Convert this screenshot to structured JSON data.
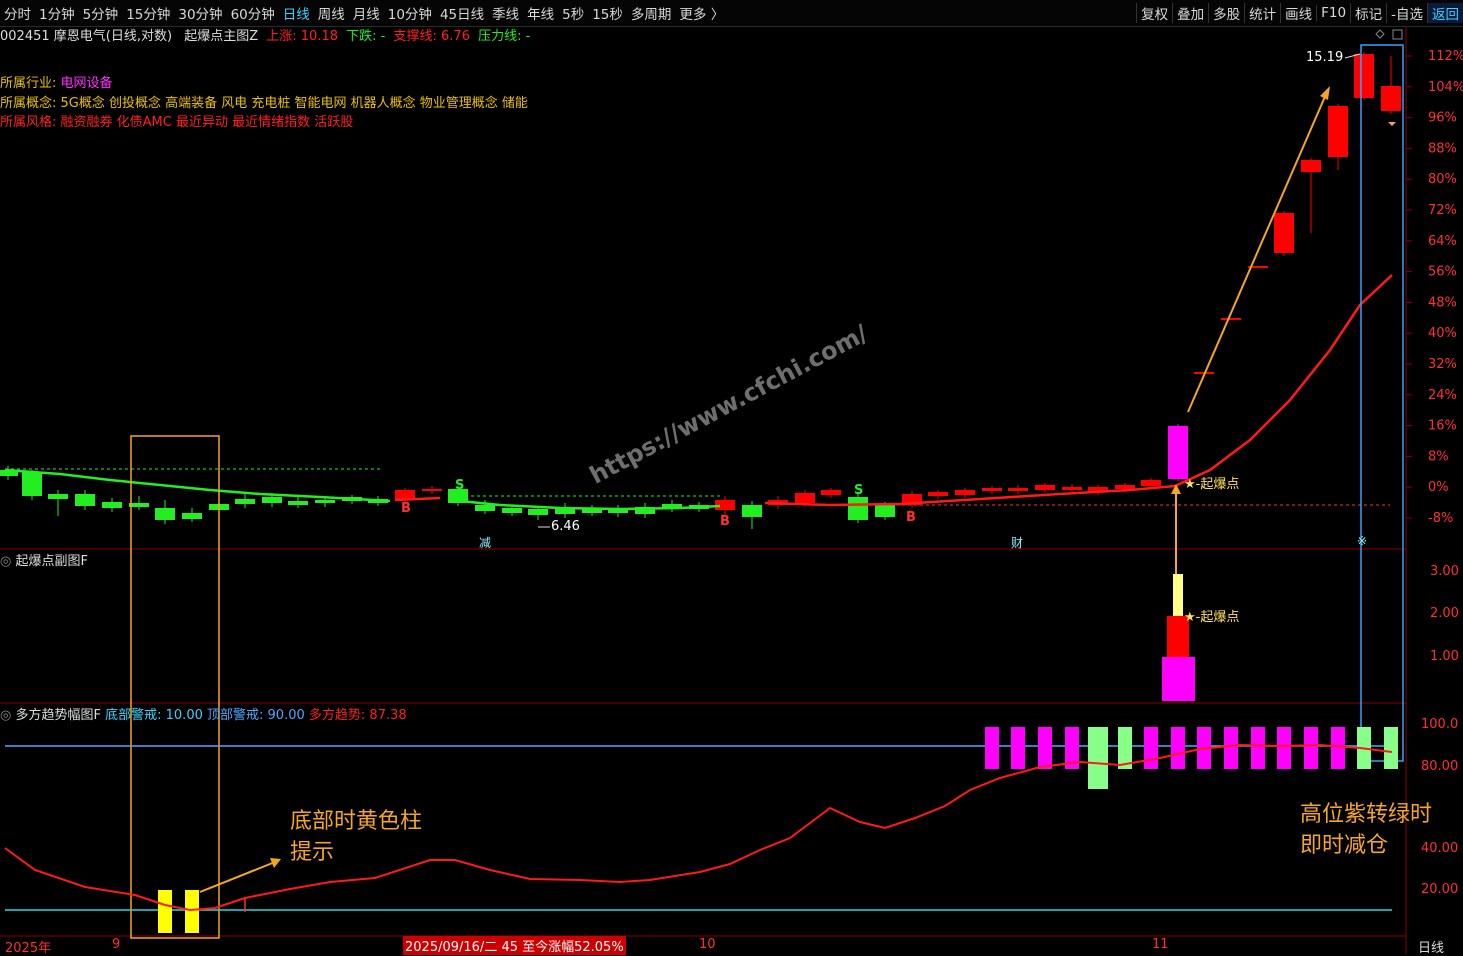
{
  "toolbar": {
    "tabs": [
      "分时",
      "1分钟",
      "5分钟",
      "15分钟",
      "30分钟",
      "60分钟",
      "日线",
      "周线",
      "月线",
      "10分钟",
      "45日线",
      "季线",
      "年线",
      "5秒",
      "15秒",
      "多周期",
      "更多 〉"
    ],
    "active": "日线",
    "tools": [
      "复权",
      "叠加",
      "多股",
      "统计",
      "画线",
      "F10",
      "标记",
      "-自选",
      "返回"
    ]
  },
  "main_panel": {
    "stock_title": "002451 摩恩电气(日线,对数)",
    "indicator_name": "起爆点主图Z",
    "up_label": "上涨:",
    "up_value": "10.18",
    "down_label": "下跌:",
    "down_value": "-",
    "support_label": "支撑线:",
    "support_value": "6.76",
    "pressure_label": "压力线:",
    "pressure_value": "-",
    "industry_label": "所属行业:",
    "industry_value": "电网设备",
    "concept_label": "所属概念:",
    "concept_value": "5G概念 创投概念 高端装备 风电 充电桩 智能电网 机器人概念 物业管理概念 储能",
    "style_label": "所属风格:",
    "style_value": "融资融券 化债AMC 最近异动 最近情绪指数 活跃股",
    "axis_labels": [
      "112%",
      "104%",
      "96%",
      "88%",
      "80%",
      "72%",
      "64%",
      "56%",
      "48%",
      "40%",
      "32%",
      "24%",
      "16%",
      "8%",
      "0%",
      "-8%"
    ],
    "high_price": "15.19",
    "low_price": "6.46",
    "qibao_tag": "起爆点",
    "signals": [
      "B",
      "S",
      "B",
      "S",
      "B"
    ],
    "events": [
      "减",
      "财",
      "※"
    ]
  },
  "sub_panel": {
    "title": "起爆点副图F",
    "axis_labels": [
      "3.00",
      "2.00",
      "1.00"
    ],
    "qibao_tag": "起爆点"
  },
  "trend_panel": {
    "title": "多方趋势幅图F",
    "bottom_warn_label": "底部警戒:",
    "bottom_warn_value": "10.00",
    "top_warn_label": "顶部警戒:",
    "top_warn_value": "90.00",
    "trend_label": "多方趋势:",
    "trend_value": "87.38",
    "axis_labels": [
      "100.0",
      "80.00",
      "40.00",
      "20.00"
    ]
  },
  "annotations": {
    "bottom_note_line1": "底部时黄色柱",
    "bottom_note_line2": "提示",
    "top_note_line1": "高位紫转绿时",
    "top_note_line2": "即时减仓"
  },
  "watermark": "https://www.cfchi.com/",
  "date_axis": {
    "labels": [
      "2025年",
      "9",
      "10",
      "11"
    ],
    "highlight": "2025/09/16/二 45 至今涨幅52.05%",
    "period": "日线"
  },
  "colors": {
    "up": "#ff2020",
    "down": "#22ee22",
    "magenta": "#ff00ff",
    "yellow": "#ffff00",
    "orange": "#f5a623",
    "cyan": "#39d2ff"
  }
}
